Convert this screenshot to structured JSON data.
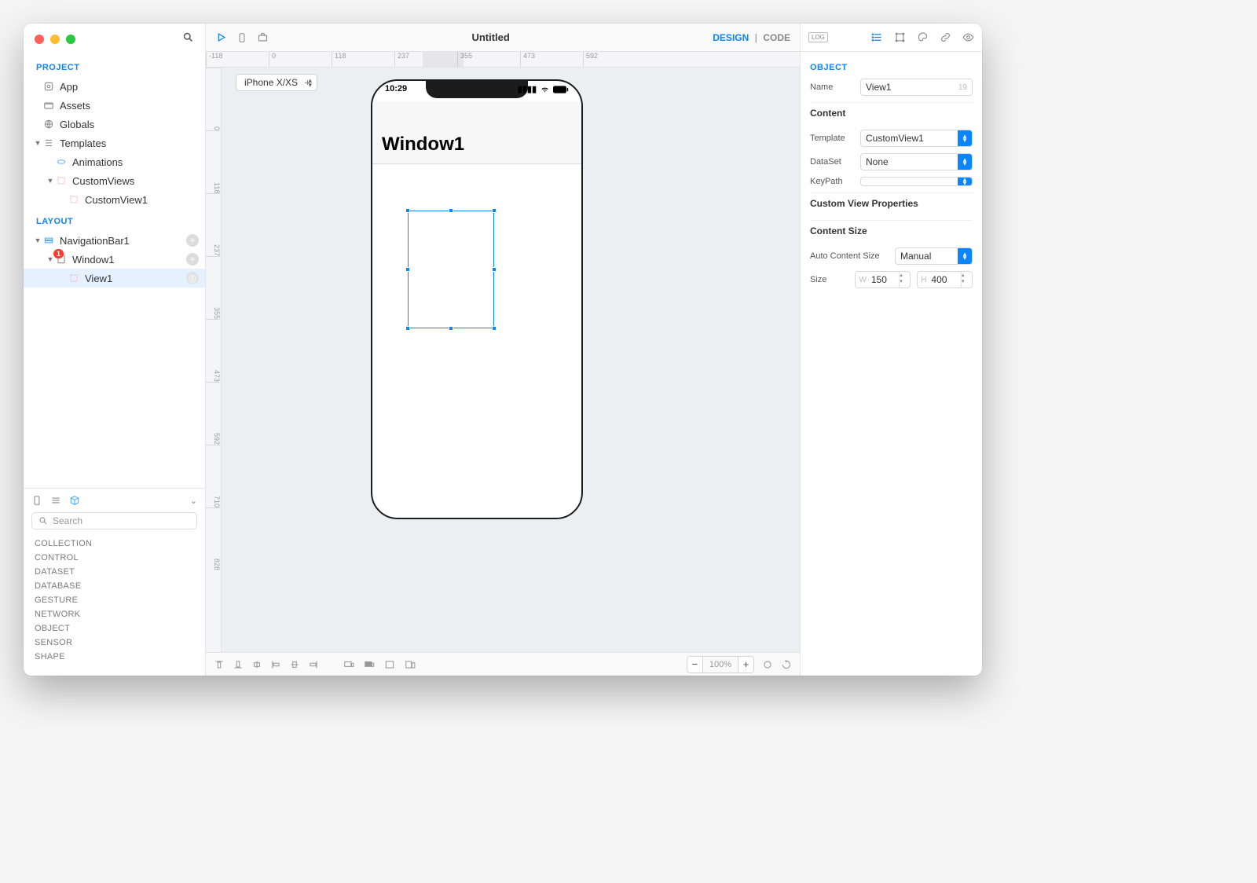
{
  "toolbar": {
    "title": "Untitled",
    "mode_design": "DESIGN",
    "mode_code": "CODE"
  },
  "sidebar": {
    "section_project": "PROJECT",
    "section_layout": "LAYOUT",
    "items": {
      "app": "App",
      "assets": "Assets",
      "globals": "Globals",
      "templates": "Templates",
      "animations": "Animations",
      "customviews": "CustomViews",
      "customview1": "CustomView1",
      "navbar1": "NavigationBar1",
      "window1": "Window1",
      "view1": "View1",
      "badge": "1"
    },
    "lib_search_placeholder": "Search",
    "lib": [
      "COLLECTION",
      "CONTROL",
      "DATASET",
      "DATABASE",
      "GESTURE",
      "NETWORK",
      "OBJECT",
      "SENSOR",
      "SHAPE"
    ]
  },
  "canvas": {
    "device": "iPhone X/XS",
    "time": "10:29",
    "window_title": "Window1",
    "ruler_h": [
      "-118",
      "0",
      "118",
      "237",
      "355",
      "473",
      "592"
    ],
    "ruler_v": [
      "0",
      "118",
      "237",
      "355",
      "473",
      "592",
      "710",
      "828"
    ],
    "zoom": "100%"
  },
  "inspector": {
    "log": "LOG",
    "section": "OBJECT",
    "name_label": "Name",
    "name_value": "View1",
    "name_count": "19",
    "content_head": "Content",
    "template_label": "Template",
    "template_value": "CustomView1",
    "dataset_label": "DataSet",
    "dataset_value": "None",
    "keypath_label": "KeyPath",
    "keypath_value": "",
    "cvprops_head": "Custom View Properties",
    "csize_head": "Content Size",
    "acs_label": "Auto Content Size",
    "acs_value": "Manual",
    "size_label": "Size",
    "size_w": "150",
    "size_h": "400"
  }
}
